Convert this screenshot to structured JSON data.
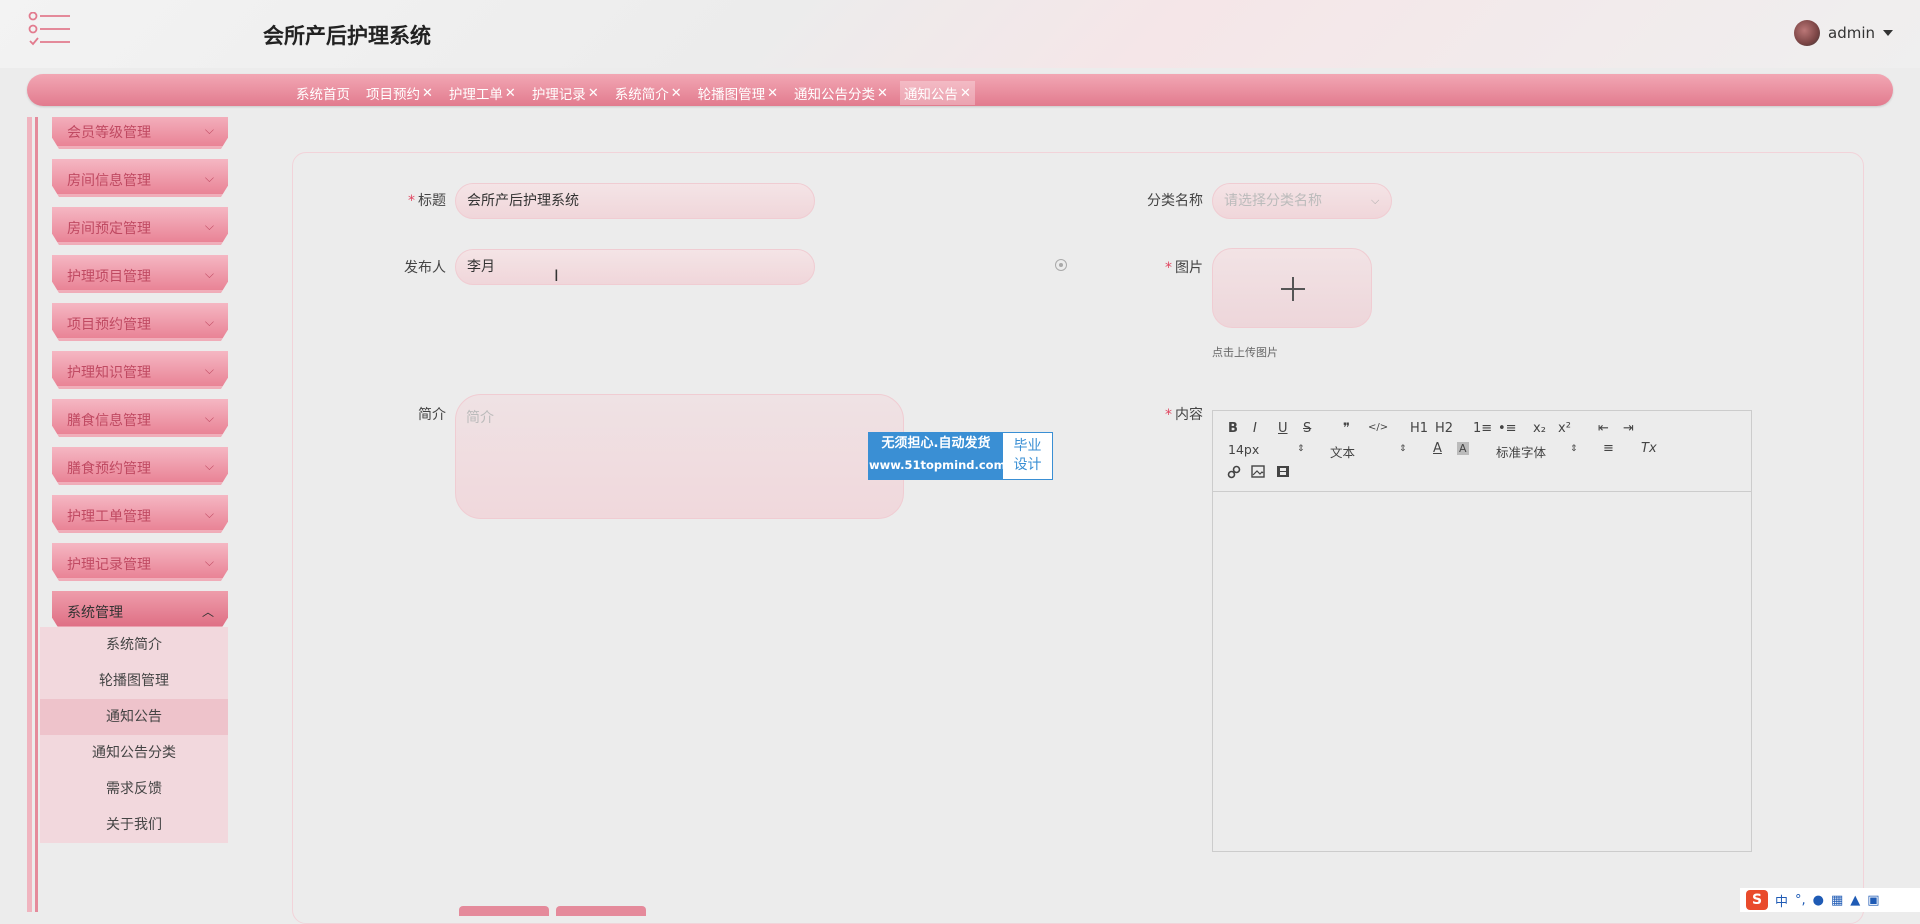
{
  "header": {
    "title": "会所产后护理系统",
    "user": "admin",
    "menu_icon": "list-menu-icon",
    "avatar_icon": "user-avatar",
    "accent": "#e27b8e"
  },
  "tabs": [
    {
      "label": "系统首页",
      "closable": false
    },
    {
      "label": "项目预约",
      "closable": true
    },
    {
      "label": "护理工单",
      "closable": true
    },
    {
      "label": "护理记录",
      "closable": true
    },
    {
      "label": "系统简介",
      "closable": true
    },
    {
      "label": "轮播图管理",
      "closable": true
    },
    {
      "label": "通知公告分类",
      "closable": true
    },
    {
      "label": "通知公告",
      "closable": true,
      "active": true
    }
  ],
  "tab_close_symbol": "✕",
  "sidebar": {
    "menus": [
      {
        "label": "会员等级管理"
      },
      {
        "label": "房间信息管理"
      },
      {
        "label": "房间预定管理"
      },
      {
        "label": "护理项目管理"
      },
      {
        "label": "项目预约管理"
      },
      {
        "label": "护理知识管理"
      },
      {
        "label": "膳食信息管理"
      },
      {
        "label": "膳食预约管理"
      },
      {
        "label": "护理工单管理"
      },
      {
        "label": "护理记录管理"
      },
      {
        "label": "系统管理",
        "open": true
      }
    ],
    "submenu": [
      {
        "label": "系统简介"
      },
      {
        "label": "轮播图管理"
      },
      {
        "label": "通知公告",
        "active": true
      },
      {
        "label": "通知公告分类"
      },
      {
        "label": "需求反馈"
      },
      {
        "label": "关于我们"
      }
    ],
    "chevron_down": "⌵",
    "chevron_up": "︿"
  },
  "form": {
    "title_label": "标题",
    "title_value": "会所产后护理系统",
    "publisher_label": "发布人",
    "publisher_value": "李月",
    "summary_label": "简介",
    "summary_placeholder": "简介",
    "category_label": "分类名称",
    "category_placeholder": "请选择分类名称",
    "image_label": "图片",
    "upload_hint": "点击上传图片",
    "content_label": "内容",
    "required_mark": "*"
  },
  "editor": {
    "font_size": "14px",
    "paragraph": "文本",
    "font_family": "标准字体",
    "buttons": [
      "B",
      "I",
      "U",
      "S",
      "❞",
      "</>",
      "H1",
      "H2",
      "1≡",
      "•≡",
      "x₂",
      "x²",
      "⇤",
      "⇥",
      "A",
      "A",
      "≡",
      "Tx"
    ]
  },
  "watermark": {
    "line1": "无须担心.自动发货",
    "line2": "www.51topmind.com",
    "right1": "毕业",
    "right2": "设计"
  },
  "ime": {
    "logo": "S",
    "lang": "中",
    "punct": "°,"
  }
}
